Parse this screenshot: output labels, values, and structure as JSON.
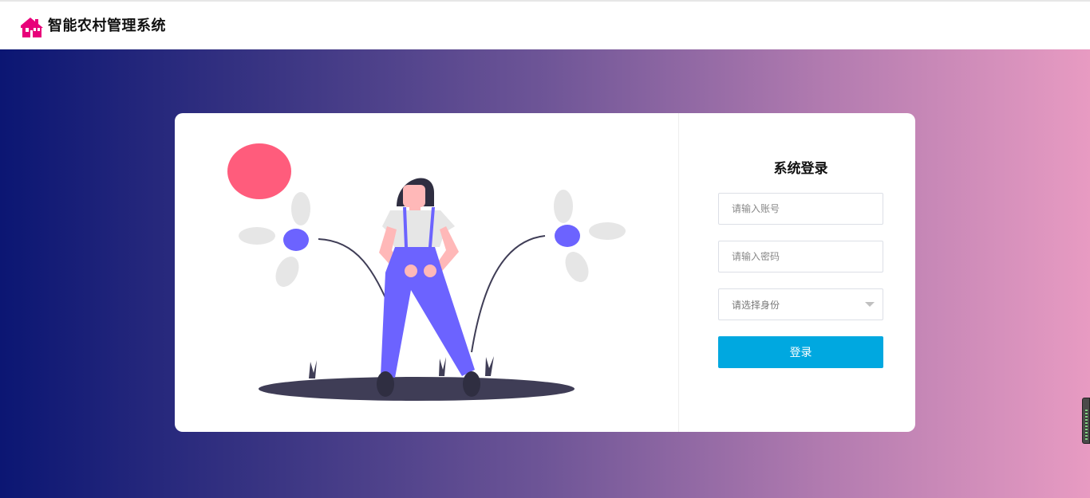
{
  "header": {
    "app_title": "智能农村管理系统",
    "logo_icon": "house-icon",
    "logo_color": "#e8007a"
  },
  "background": {
    "gradient_start": "#0b1673",
    "gradient_end": "#e89bc2"
  },
  "login": {
    "title": "系统登录",
    "username_placeholder": "请输入账号",
    "username_value": "",
    "password_placeholder": "请输入密码",
    "password_value": "",
    "role_select": {
      "placeholder": "请选择身份",
      "icon": "chevron-down-icon"
    },
    "submit_label": "登录",
    "submit_color": "#00a8e0"
  },
  "illustration": {
    "subject": "woman-with-flowers",
    "accent_colors": [
      "#ff5c7c",
      "#6c63ff",
      "#e6e6e6",
      "#3f3d56"
    ]
  },
  "side_widget": {
    "icon": "meter-icon"
  }
}
